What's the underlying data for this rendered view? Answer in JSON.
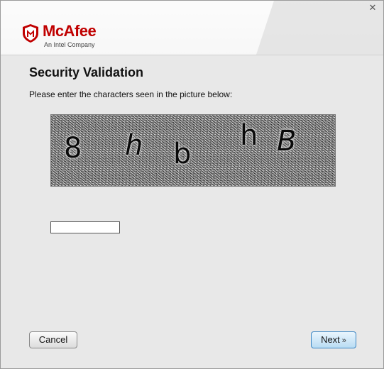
{
  "window": {
    "close_glyph": "✕"
  },
  "brand": {
    "name": "McAfee",
    "tagline": "An Intel Company",
    "color": "#c00000",
    "logo_icon": "mcafee-shield-icon"
  },
  "page": {
    "title": "Security Validation",
    "instruction": "Please enter the characters seen in the picture below:"
  },
  "captcha": {
    "chars": [
      "8",
      "h",
      "b",
      "h",
      "B"
    ]
  },
  "answer": {
    "value": "",
    "placeholder": ""
  },
  "buttons": {
    "cancel": "Cancel",
    "next": "Next",
    "next_icon": "»"
  }
}
